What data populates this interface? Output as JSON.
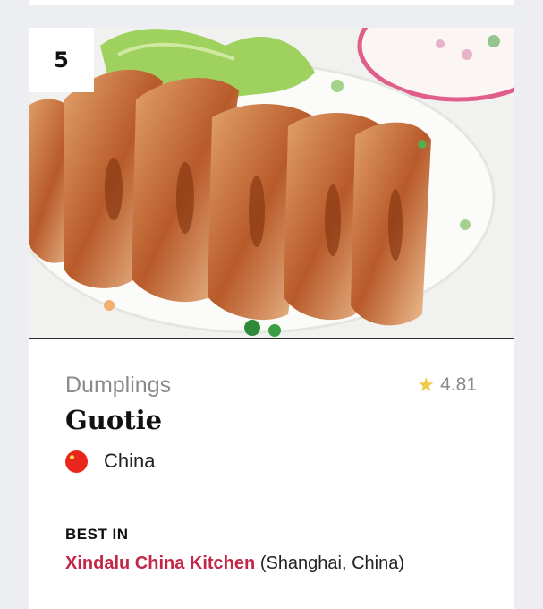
{
  "item": {
    "rank": "5",
    "category": "Dumplings",
    "rating": "4.81",
    "name": "Guotie",
    "country": "China",
    "best_in_label": "BEST IN",
    "restaurant": "Xindalu China Kitchen",
    "location": "(Shanghai, China)"
  },
  "colors": {
    "accent": "#c3284a",
    "star": "#f0c94a",
    "flag": "#e8261b"
  },
  "icons": {
    "rating": "star-icon",
    "country": "china-flag-icon"
  }
}
